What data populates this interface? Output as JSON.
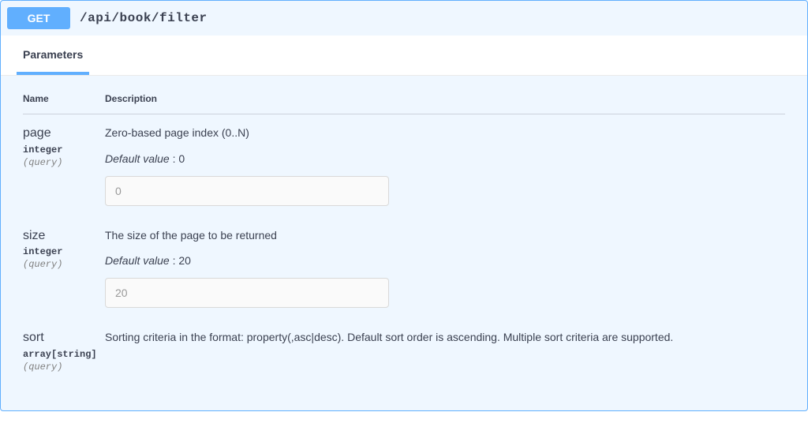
{
  "operation": {
    "method": "GET",
    "path": "/api/book/filter"
  },
  "tabs": {
    "parameters": "Parameters"
  },
  "headers": {
    "name": "Name",
    "description": "Description"
  },
  "labels": {
    "default_value": "Default value",
    "colon": " : "
  },
  "parameters": [
    {
      "name": "page",
      "type": "integer",
      "in": "(query)",
      "description": "Zero-based page index (0..N)",
      "default": "0",
      "placeholder": "0"
    },
    {
      "name": "size",
      "type": "integer",
      "in": "(query)",
      "description": "The size of the page to be returned",
      "default": "20",
      "placeholder": "20"
    },
    {
      "name": "sort",
      "type": "array[string]",
      "in": "(query)",
      "description": "Sorting criteria in the format: property(,asc|desc). Default sort order is ascending. Multiple sort criteria are supported."
    }
  ]
}
